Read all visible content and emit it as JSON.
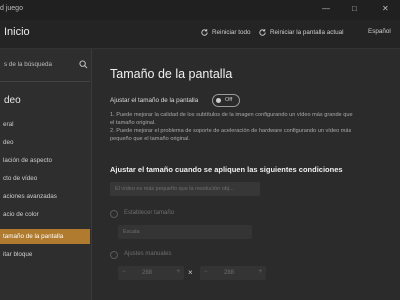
{
  "window": {
    "title": "d juego",
    "minimize": "—",
    "maximize": "□",
    "close": "✕"
  },
  "header": {
    "home_title": "Inicio",
    "reset_all": "Reiniciar todo",
    "reset_screen": "Reiniciar la pantalla actual",
    "language": "Español"
  },
  "sidebar": {
    "search_placeholder": "s de la búsqueda",
    "section_title": "deo",
    "items": [
      {
        "label": "eral",
        "active": false
      },
      {
        "label": "deo",
        "active": false
      },
      {
        "label": "lación de aspecto",
        "active": false
      },
      {
        "label": "cto de vídeo",
        "active": false
      },
      {
        "label": "aciones avanzadas",
        "active": false
      },
      {
        "label": "acio de color",
        "active": false
      },
      {
        "label": "tamaño de la pantalla",
        "active": true
      },
      {
        "label": "itar bloque",
        "active": false
      }
    ]
  },
  "main": {
    "title": "Tamaño de la pantalla",
    "toggle_label": "Ajustar el tamaño de la pantalla",
    "toggle_state": "Off",
    "notes": [
      "1. Puede mejorar la calidad de los subtítulos de la imagen configurando un vídeo más grande que",
      "el tamaño original.",
      "2. Puede mejorar el problema de soporte de aceleración de hardware configurando un vídeo más",
      "pequeño que el tamaño original."
    ],
    "conditions_title": "Ajustar el tamaño cuando se apliquen las siguientes condiciones",
    "condition_dropdown_value": "El vídeo es más pequeño que la resolución obj...",
    "preset_label": "Establecer tamaño",
    "preset_value": "Escala",
    "manual_label": "Ajustes manuales",
    "width_value": "288",
    "height_value": "288",
    "times_symbol": "×",
    "minus": "−",
    "plus": "+"
  }
}
